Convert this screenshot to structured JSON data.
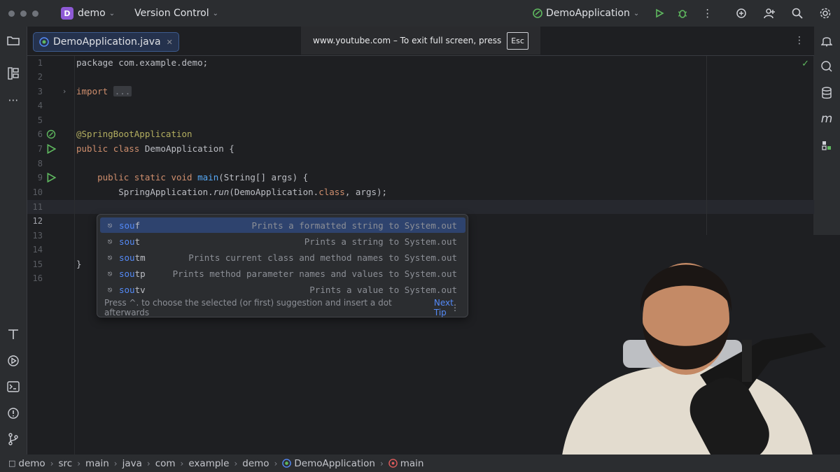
{
  "titlebar": {
    "project_initial": "D",
    "project_name": "demo",
    "vcs_label": "Version Control",
    "run_config": "DemoApplication"
  },
  "editor": {
    "tab_label": "DemoApplication.java",
    "fullscreen_notice": "www.youtube.com – To exit full screen, press",
    "fullscreen_key": "Esc",
    "current_line_number": "12"
  },
  "code_lines": [
    {
      "n": "1",
      "text": "package com.example.demo;"
    },
    {
      "n": "2",
      "text": ""
    },
    {
      "n": "3",
      "kw": "import",
      "fold": "..."
    },
    {
      "n": "4",
      "text": ""
    },
    {
      "n": "5",
      "text": ""
    },
    {
      "n": "6",
      "ann": "@SpringBootApplication"
    },
    {
      "n": "7",
      "kw1": "public",
      "kw2": "class",
      "rest": "DemoApplication {"
    },
    {
      "n": "8",
      "text": ""
    },
    {
      "n": "9",
      "kw1": "public",
      "kw2": "static",
      "kw3": "void",
      "fn": "main",
      "rest": "(String[] args) {"
    },
    {
      "n": "10",
      "cls": "SpringApplication.",
      "method": "run",
      "arg": "(DemoApplication.",
      "kw": "class",
      "rest": ", args);"
    },
    {
      "n": "11",
      "text": ""
    },
    {
      "n": "12",
      "typed": "sou"
    },
    {
      "n": "13",
      "text": ""
    },
    {
      "n": "14",
      "text": ""
    },
    {
      "n": "15",
      "text": "}"
    },
    {
      "n": "16",
      "text": ""
    }
  ],
  "completion": {
    "items": [
      {
        "match": "sou",
        "rest": "f",
        "description": "Prints a formatted string to System.out"
      },
      {
        "match": "sou",
        "rest": "t",
        "description": "Prints a string to System.out"
      },
      {
        "match": "sou",
        "rest": "tm",
        "description": "Prints current class and method names to System.out"
      },
      {
        "match": "sou",
        "rest": "tp",
        "description": "Prints method parameter names and values to System.out"
      },
      {
        "match": "sou",
        "rest": "tv",
        "description": "Prints a value to System.out"
      }
    ],
    "footer_hint": "Press ^. to choose the selected (or first) suggestion and insert a dot afterwards",
    "footer_tip": "Next Tip"
  },
  "breadcrumbs": [
    "demo",
    "src",
    "main",
    "java",
    "com",
    "example",
    "demo",
    "DemoApplication",
    "main"
  ],
  "colors": {
    "accent": "#548af7",
    "keyword": "#cf8e6d",
    "annotation": "#b3ae60",
    "function": "#56a8f5",
    "run_green": "#5fb85f"
  }
}
